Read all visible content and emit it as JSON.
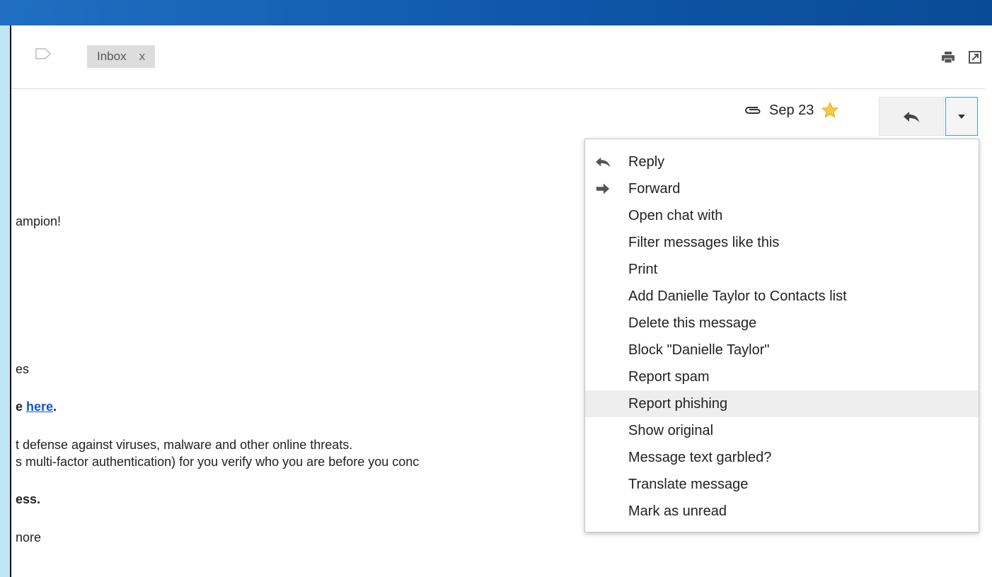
{
  "header": {
    "label_chip": "Inbox",
    "label_remove": "x"
  },
  "message": {
    "date": "Sep 23",
    "body_lines": [
      "ampion!",
      "es",
      "e ",
      "here",
      ".",
      "t defense against viruses, malware and other online threats.",
      "s multi-factor authentication) for you verify who you are before you conc",
      "ess.",
      "nore"
    ]
  },
  "menu": {
    "items": [
      {
        "label": "Reply",
        "icon": "reply-icon"
      },
      {
        "label": "Forward",
        "icon": "forward-icon"
      },
      {
        "label": "Open chat with"
      },
      {
        "label": "Filter messages like this"
      },
      {
        "label": "Print"
      },
      {
        "label": "Add Danielle Taylor to Contacts list"
      },
      {
        "label": "Delete this message"
      },
      {
        "label": "Block \"Danielle Taylor\""
      },
      {
        "label": "Report spam"
      },
      {
        "label": "Report phishing",
        "highlighted": true
      },
      {
        "label": "Show original"
      },
      {
        "label": "Message text garbled?"
      },
      {
        "label": "Translate message"
      },
      {
        "label": "Mark as unread"
      }
    ]
  },
  "colors": {
    "accent_blue": "#1155cc",
    "star": "#f7c948",
    "topbar": "#0e55a6"
  }
}
